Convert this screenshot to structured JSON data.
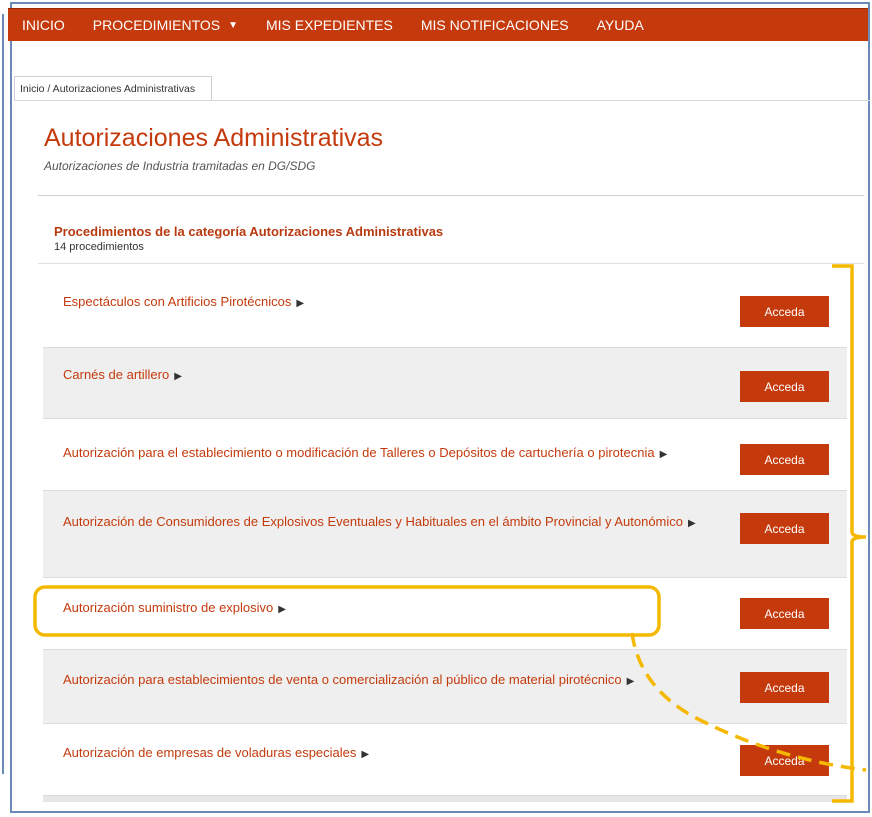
{
  "nav": {
    "items": [
      {
        "label": "INICIO"
      },
      {
        "label": "PROCEDIMIENTOS"
      },
      {
        "label": "MIS EXPEDIENTES"
      },
      {
        "label": "MIS NOTIFICACIONES"
      },
      {
        "label": "AYUDA"
      }
    ],
    "dropdown_icon": "caret-down-icon"
  },
  "breadcrumb": "Inicio / Autorizaciones Administrativas",
  "page": {
    "title": "Autorizaciones Administrativas",
    "subtitle": "Autorizaciones de Industria tramitadas en DG/SDG"
  },
  "section": {
    "title": "Procedimientos de la categoría Autorizaciones Administrativas",
    "count": "14 procedimientos"
  },
  "procedures": [
    {
      "title": "Espectáculos con Artificios Pirotécnicos",
      "button": "Acceda"
    },
    {
      "title": "Carnés de artillero",
      "button": "Acceda"
    },
    {
      "title": "Autorización para el establecimiento o modificación de Talleres o Depósitos de cartuchería o pirotecnia",
      "button": "Acceda"
    },
    {
      "title": "Autorización de Consumidores de Explosivos Eventuales y Habituales en el ámbito Provincial y Autonómico",
      "button": "Acceda"
    },
    {
      "title": "Autorización suministro de explosivo",
      "button": "Acceda"
    },
    {
      "title": "Autorización para establecimientos de venta o comercialización al público de material pirotécnico",
      "button": "Acceda"
    },
    {
      "title": "Autorización de empresas de voladuras especiales",
      "button": "Acceda"
    }
  ],
  "colors": {
    "brand": "#c53a0c",
    "highlight": "#f5b800",
    "frame": "#6a8bb8",
    "row_alt": "#efefef"
  }
}
